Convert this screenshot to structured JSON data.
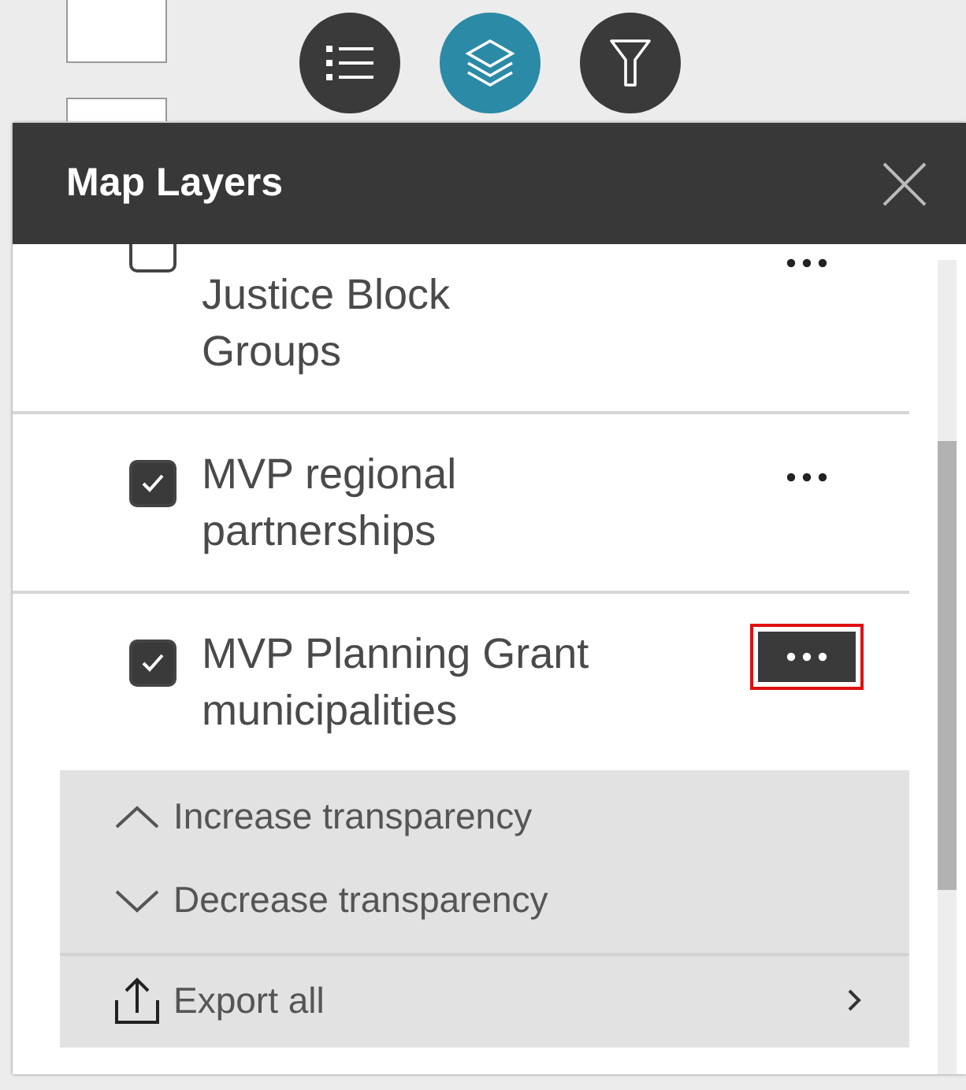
{
  "toolbar": [
    {
      "kind": "list",
      "selected": false
    },
    {
      "kind": "layers",
      "selected": true
    },
    {
      "kind": "filter",
      "selected": false
    }
  ],
  "panel": {
    "title": "Map Layers"
  },
  "layers": [
    {
      "lines": [
        "Justice Block",
        "Groups"
      ],
      "checked": false,
      "menu_open": false
    },
    {
      "lines": [
        "MVP regional",
        "partnerships"
      ],
      "checked": true,
      "menu_open": false
    },
    {
      "lines": [
        "MVP Planning Grant",
        "municipalities"
      ],
      "checked": true,
      "menu_open": true
    }
  ],
  "layer_menu": [
    {
      "kind": "up",
      "label": "Increase transparency"
    },
    {
      "kind": "down",
      "label": "Decrease transparency"
    },
    {
      "kind": "export",
      "label": "Export all"
    }
  ]
}
